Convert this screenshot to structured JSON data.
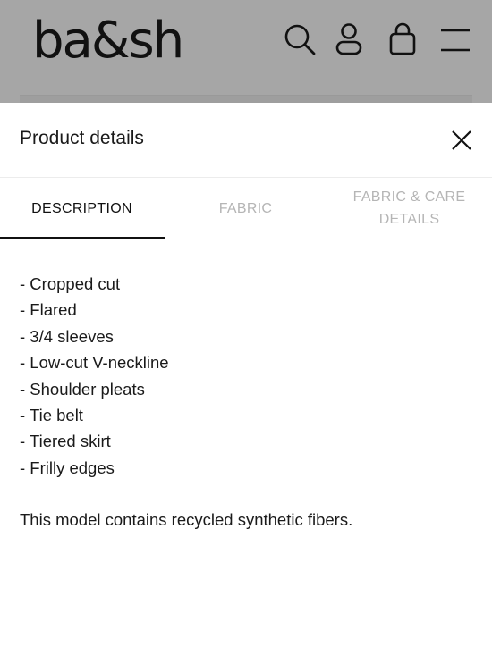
{
  "header": {
    "logo": "ba&sh",
    "icons": [
      "search-icon",
      "account-icon",
      "bag-icon",
      "menu-icon"
    ]
  },
  "panel": {
    "title": "Product details",
    "close_icon": "close-icon"
  },
  "tabs": [
    {
      "label": "DESCRIPTION",
      "active": true
    },
    {
      "label": "FABRIC",
      "active": false
    },
    {
      "label": "FABRIC & CARE DETAILS",
      "active": false
    }
  ],
  "description": {
    "items": [
      "- Cropped cut",
      "- Flared",
      "- 3/4 sleeves",
      "- Low-cut V-neckline",
      "- Shoulder pleats",
      "- Tie belt",
      "- Tiered skirt",
      "- Frilly edges"
    ],
    "note": "This model contains recycled synthetic fibers."
  },
  "colors": {
    "header_bg": "#a6a6a6",
    "text": "#1a1a1a",
    "inactive_tab": "#b5b5b5",
    "accent": "#111111"
  }
}
